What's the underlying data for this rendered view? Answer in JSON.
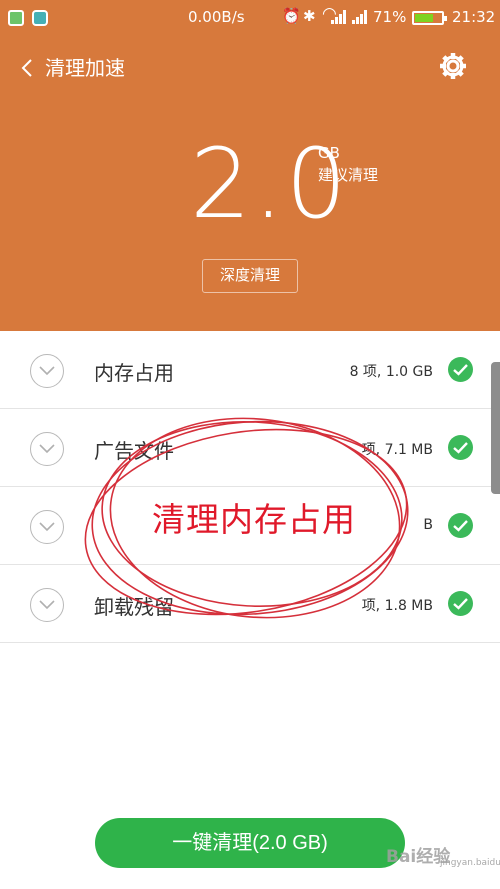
{
  "statusbar": {
    "net_speed": "0.00B/s",
    "alarm_glyph": "⏰",
    "bluetooth_glyph": "✱",
    "wifi_glyph": "◠",
    "battery": "71%",
    "battery_level": 0.71,
    "time": "21:32"
  },
  "header": {
    "title": "清理加速",
    "size_value": "2.0",
    "size_unit": "GB",
    "size_caption": "建议清理",
    "deep_clean_label": "深度清理"
  },
  "items": [
    {
      "label": "内存占用",
      "stats": "8 项, 1.0 GB"
    },
    {
      "label": "广告文件",
      "stats": "项, 7.1 MB"
    },
    {
      "label": "",
      "stats": "B"
    },
    {
      "label": "卸载残留",
      "stats": "项, 1.8 MB"
    }
  ],
  "annotation": {
    "text": "清理内存占用"
  },
  "footer": {
    "clean_button_label": "一键清理(2.0 GB)"
  },
  "watermark": {
    "text": "Bai经验",
    "sub": "jingyan.baidu.com"
  },
  "colors": {
    "header_bg": "#d7793c",
    "check_green": "#3bb95a",
    "button_green": "#2fb34a",
    "annotation_red": "#e0192a"
  }
}
